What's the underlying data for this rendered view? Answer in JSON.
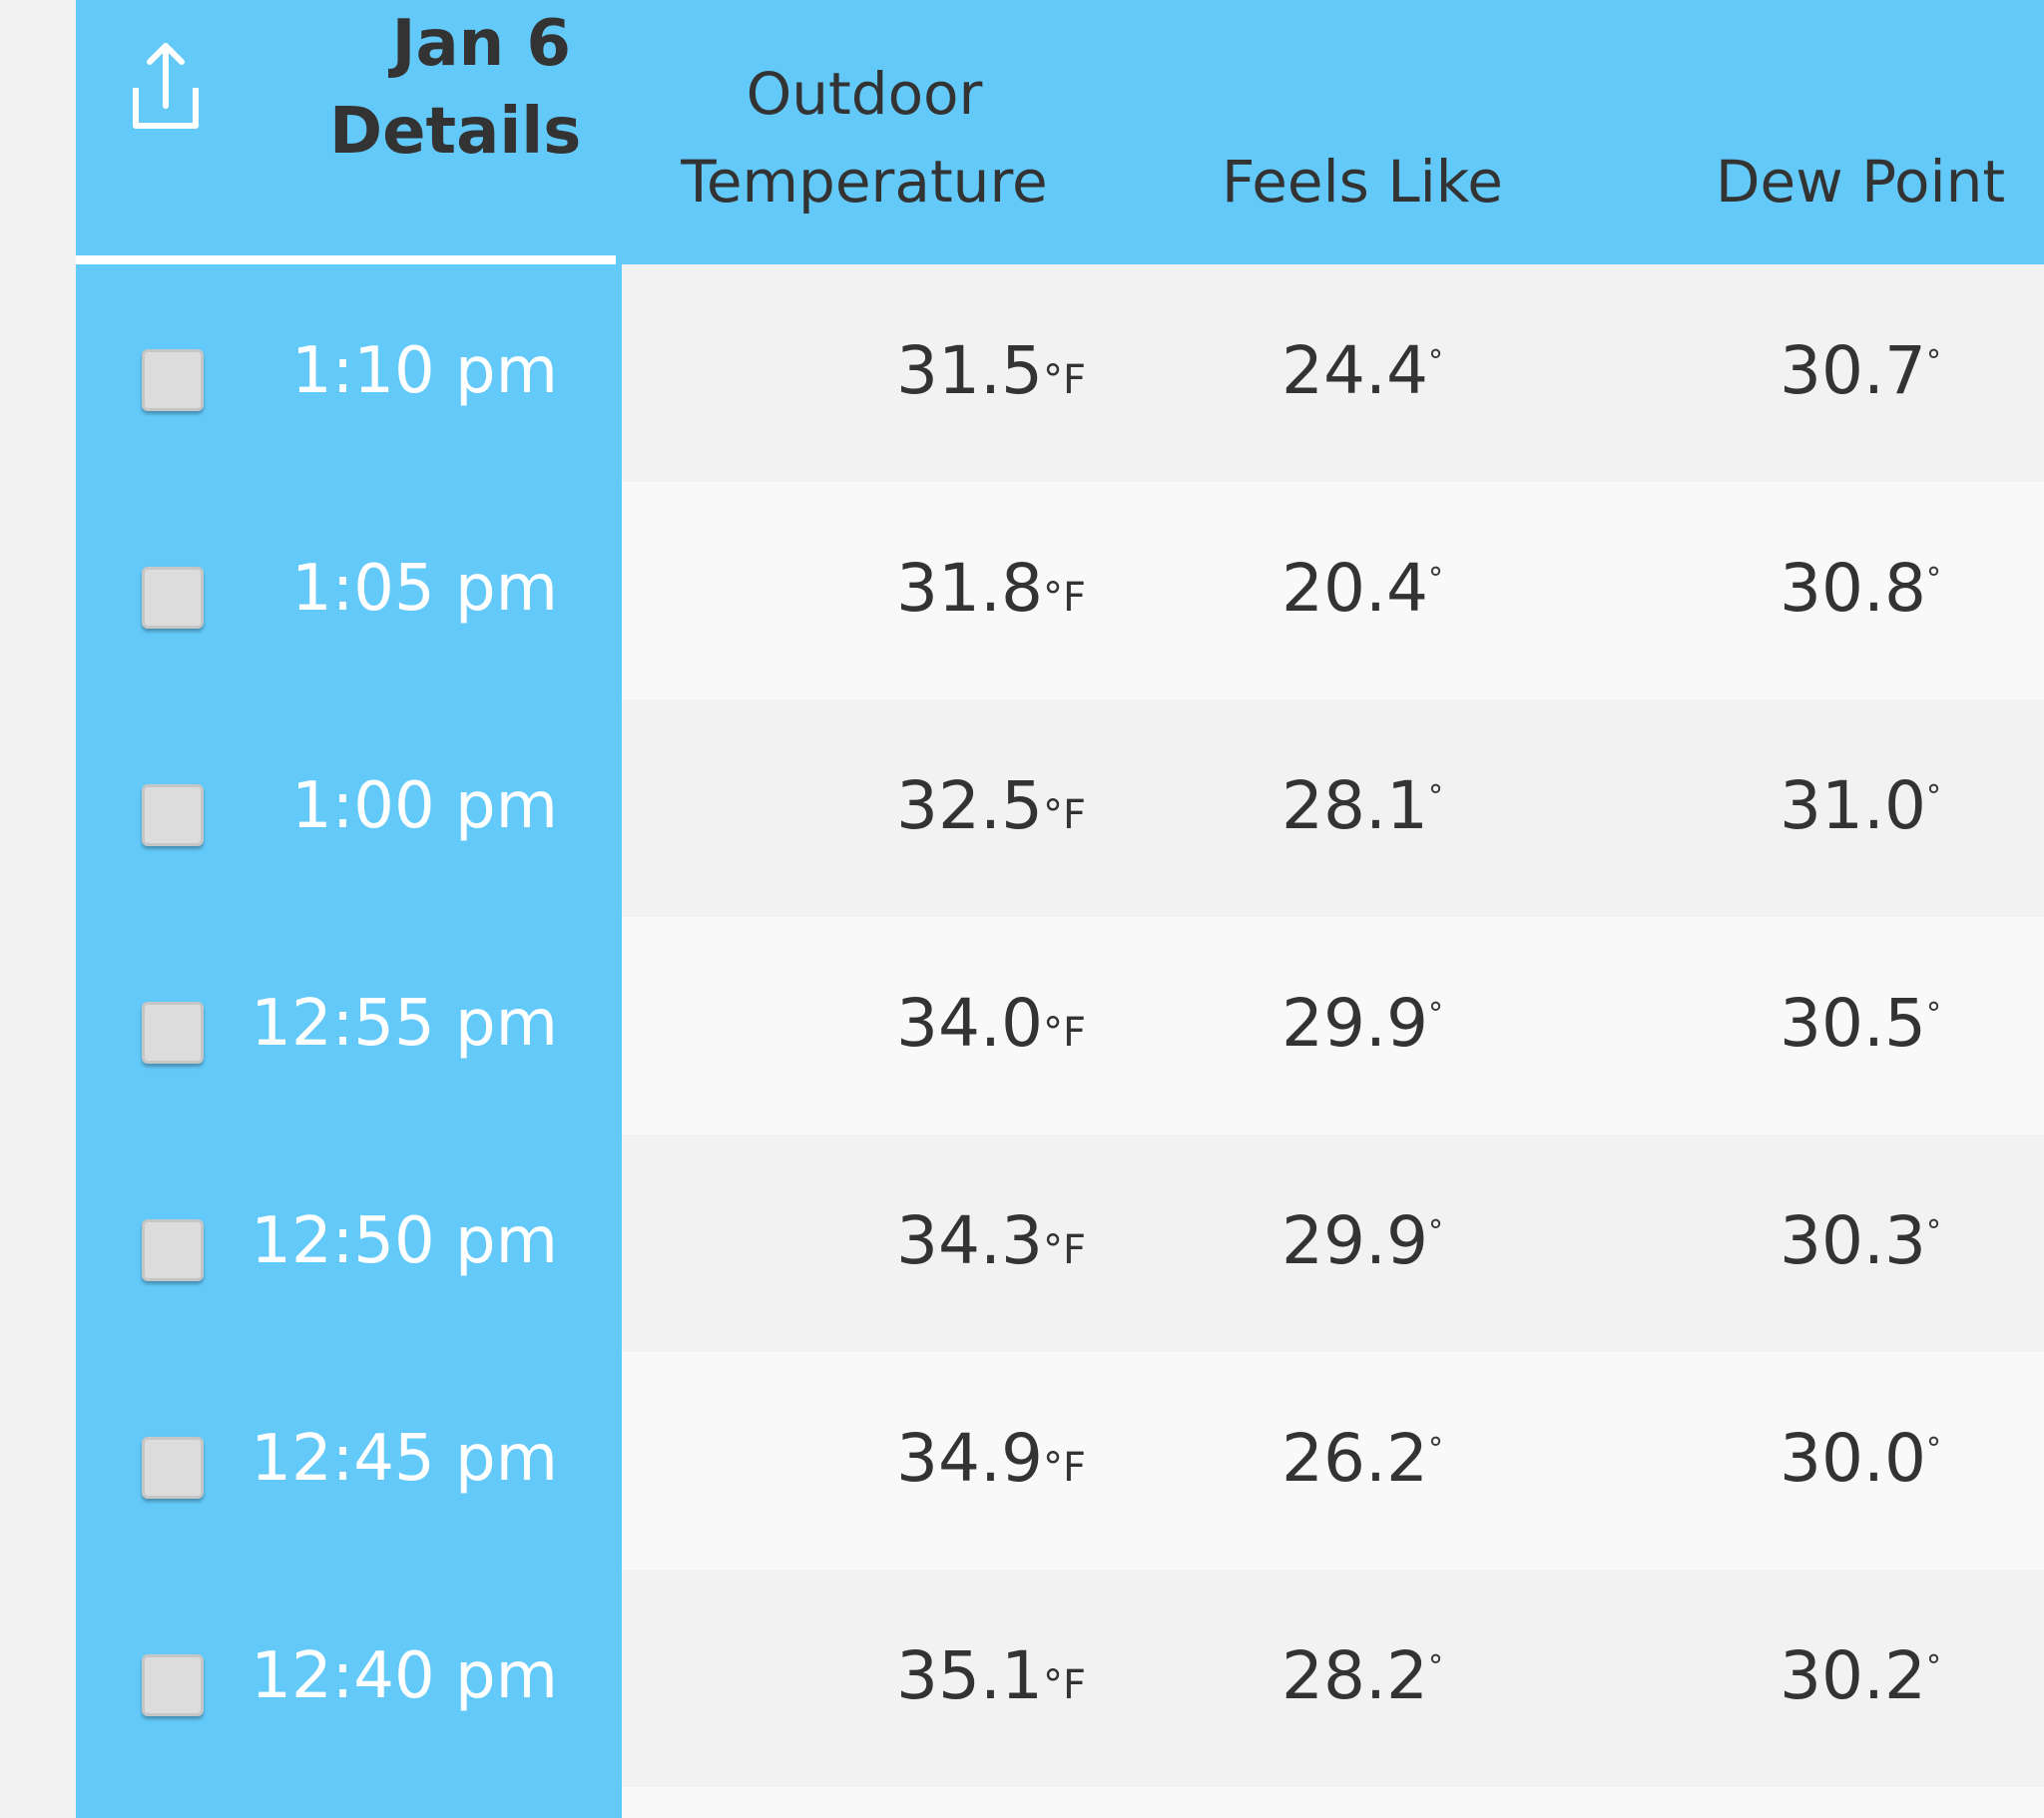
{
  "header": {
    "date_line1": "Jan 6",
    "date_line2": "Details",
    "share_icon": "share-upload-icon",
    "columns": {
      "outdoor_line1": "Outdoor",
      "outdoor_line2": "Temperature",
      "feels_like": "Feels Like",
      "dew_point": "Dew Point"
    }
  },
  "colors": {
    "accent_blue": "#63c9f8",
    "row_odd": "#f2f2f2",
    "row_even": "#f9f9f9",
    "text_dark": "#333333",
    "time_text": "#ffffff"
  },
  "rows": [
    {
      "time": "1:10 pm",
      "outdoor": "31.5",
      "outdoor_unit": "°F",
      "feels": "24.4",
      "feels_unit": "°",
      "dew": "30.7",
      "dew_unit": "°"
    },
    {
      "time": "1:05 pm",
      "outdoor": "31.8",
      "outdoor_unit": "°F",
      "feels": "20.4",
      "feels_unit": "°",
      "dew": "30.8",
      "dew_unit": "°"
    },
    {
      "time": "1:00 pm",
      "outdoor": "32.5",
      "outdoor_unit": "°F",
      "feels": "28.1",
      "feels_unit": "°",
      "dew": "31.0",
      "dew_unit": "°"
    },
    {
      "time": "12:55 pm",
      "outdoor": "34.0",
      "outdoor_unit": "°F",
      "feels": "29.9",
      "feels_unit": "°",
      "dew": "30.5",
      "dew_unit": "°"
    },
    {
      "time": "12:50 pm",
      "outdoor": "34.3",
      "outdoor_unit": "°F",
      "feels": "29.9",
      "feels_unit": "°",
      "dew": "30.3",
      "dew_unit": "°"
    },
    {
      "time": "12:45 pm",
      "outdoor": "34.9",
      "outdoor_unit": "°F",
      "feels": "26.2",
      "feels_unit": "°",
      "dew": "30.0",
      "dew_unit": "°"
    },
    {
      "time": "12:40 pm",
      "outdoor": "35.1",
      "outdoor_unit": "°F",
      "feels": "28.2",
      "feels_unit": "°",
      "dew": "30.2",
      "dew_unit": "°"
    }
  ]
}
